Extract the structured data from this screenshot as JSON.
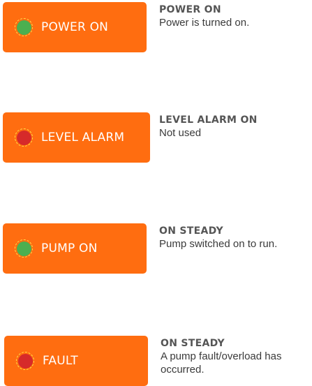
{
  "colors": {
    "panel": "#ff6d10",
    "led_green": "#4caf50",
    "led_red": "#d62a2a",
    "led_ring": "#ffe24a",
    "title": "#555555",
    "text": "#3a3a3a"
  },
  "indicators": [
    {
      "label": "POWER ON",
      "led": "green",
      "title": "POWER ON",
      "description": "Power is turned on."
    },
    {
      "label": "LEVEL ALARM",
      "led": "red",
      "title": "LEVEL ALARM ON",
      "description": "Not used"
    },
    {
      "label": "PUMP ON",
      "led": "green",
      "title": "ON STEADY",
      "description": "Pump switched on to run."
    },
    {
      "label": "FAULT",
      "led": "red",
      "title": "ON STEADY",
      "description": "A pump fault/overload has occurred."
    }
  ]
}
